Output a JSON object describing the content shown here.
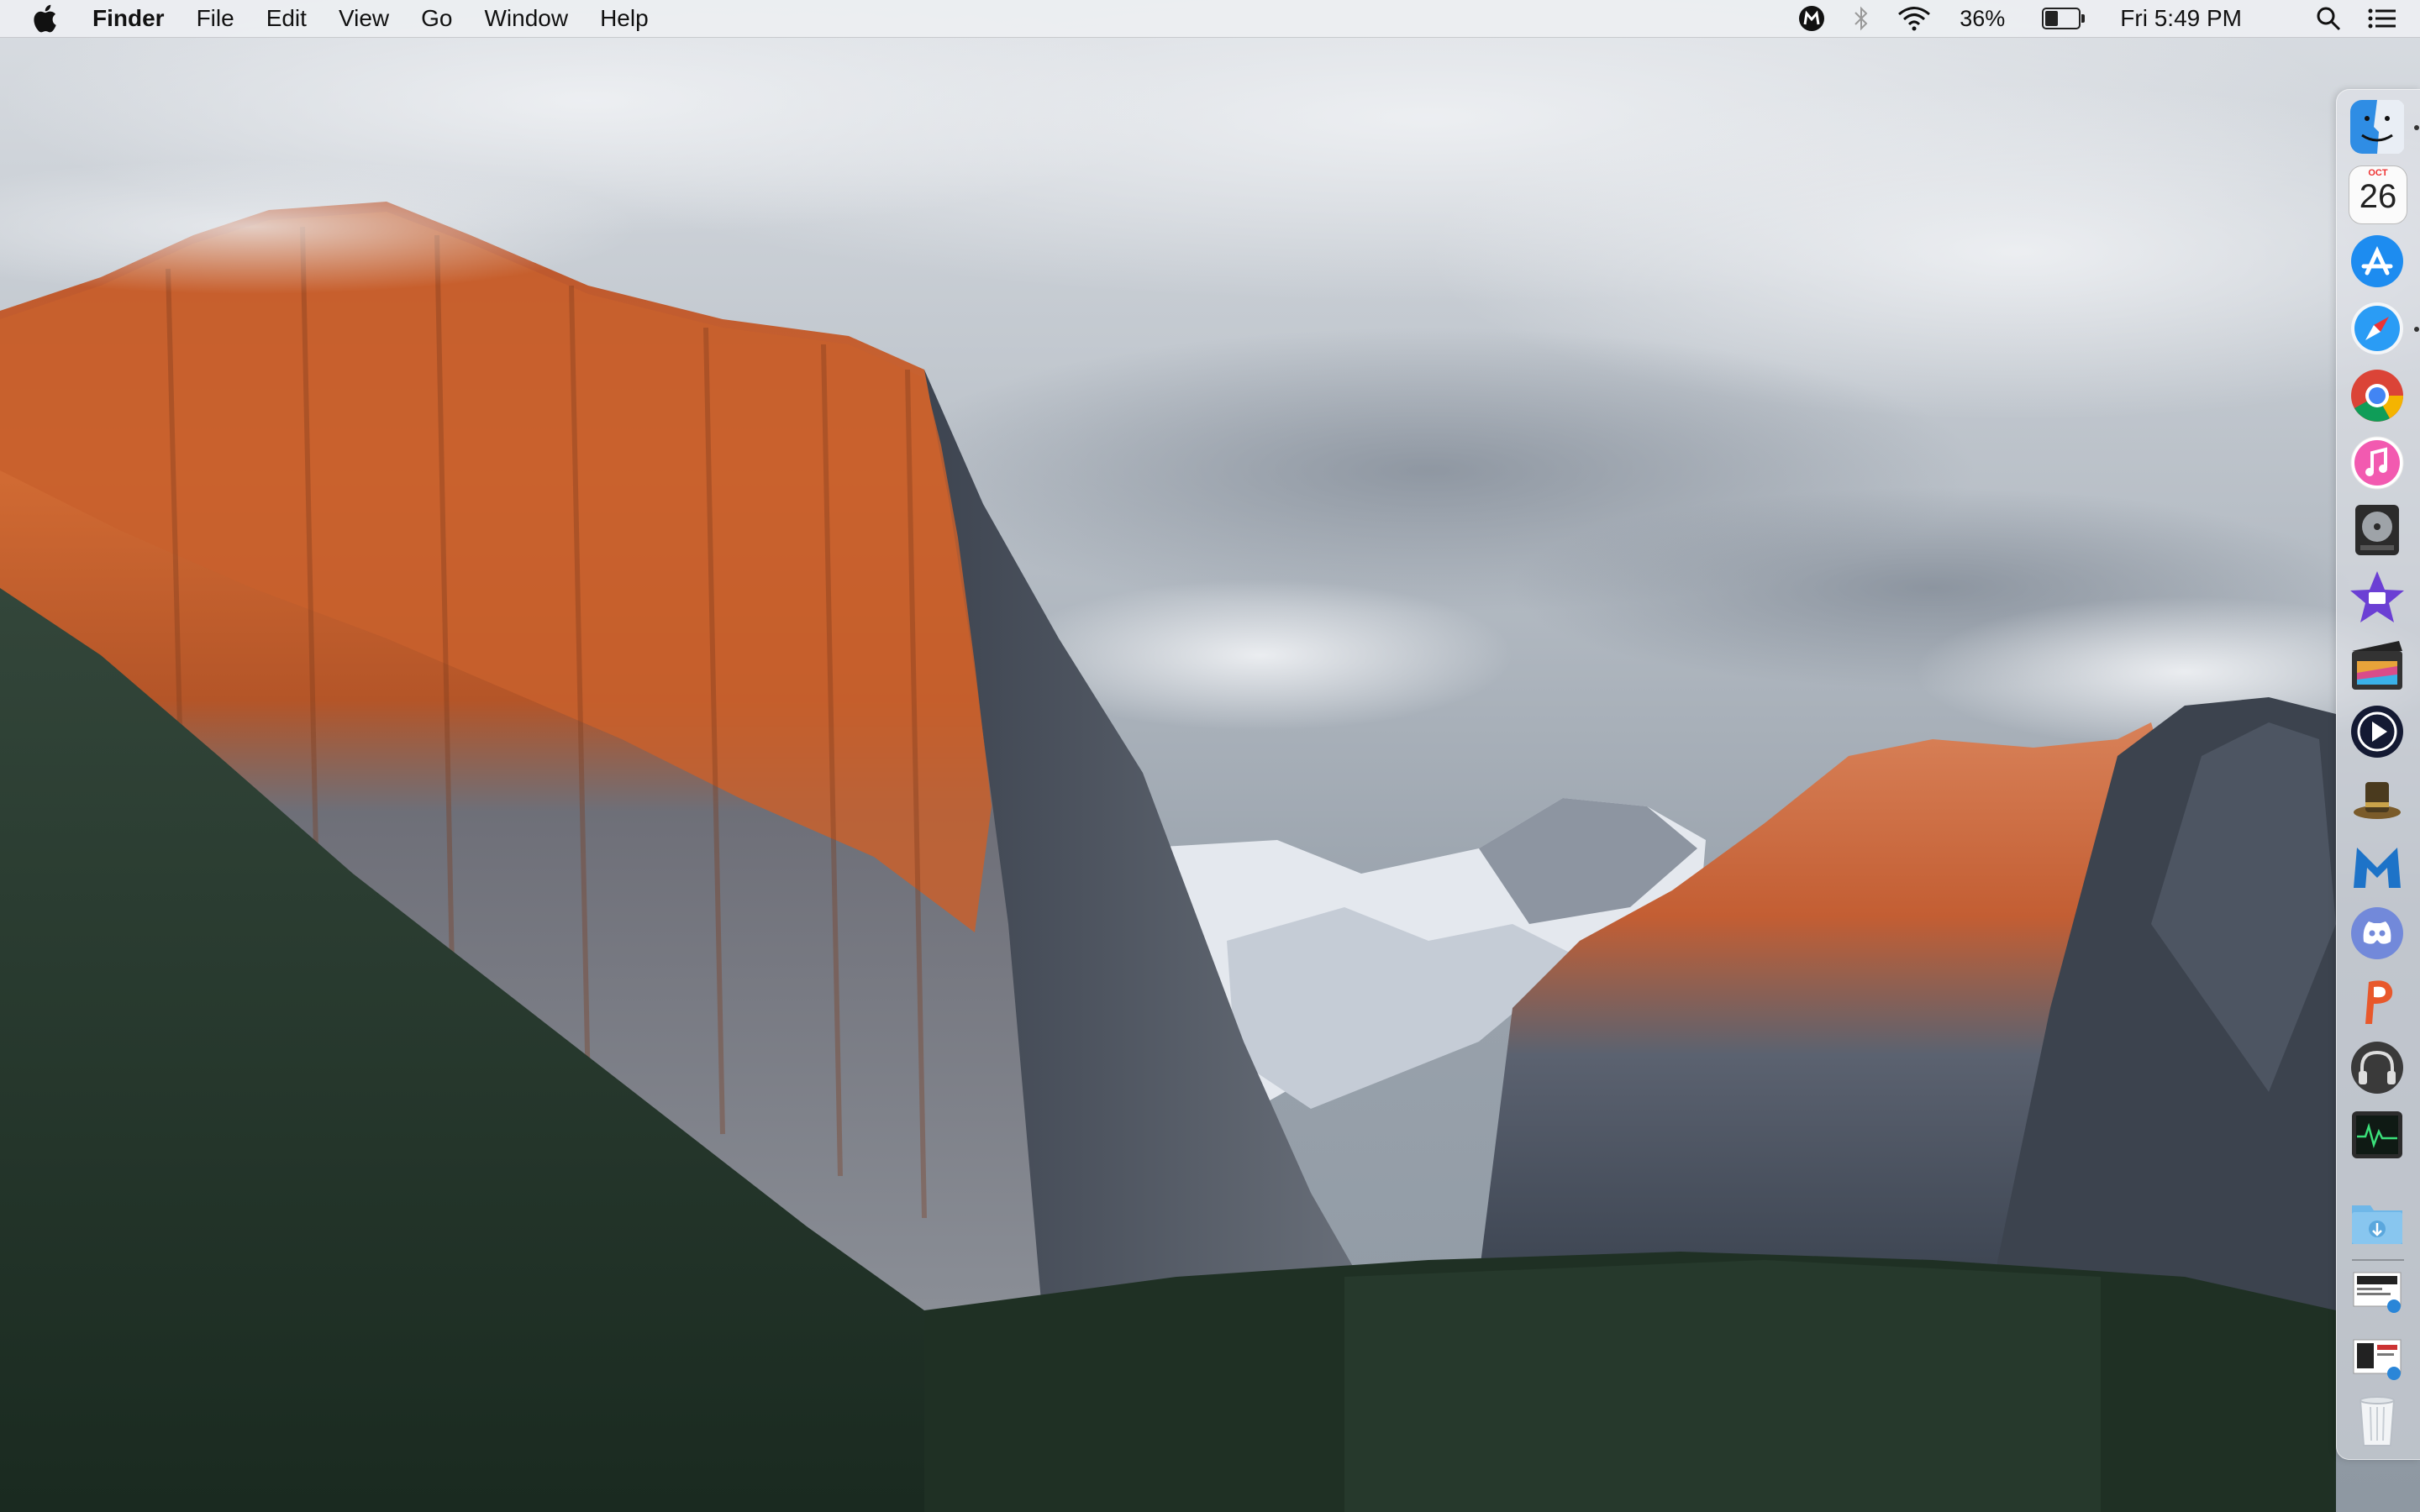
{
  "menubar": {
    "app_name": "Finder",
    "menus": [
      "File",
      "Edit",
      "View",
      "Go",
      "Window",
      "Help"
    ],
    "battery_percent": "36%",
    "battery_level": 0.36,
    "clock": "Fri 5:49 PM"
  },
  "dock": {
    "items": [
      {
        "name": "Finder",
        "icon": "finder-icon",
        "running": true
      },
      {
        "name": "Calendar",
        "icon": "calendar-icon",
        "month": "OCT",
        "day": "26"
      },
      {
        "name": "App Store",
        "icon": "app-store-icon"
      },
      {
        "name": "Safari",
        "icon": "safari-icon",
        "running": true
      },
      {
        "name": "Google Chrome",
        "icon": "chrome-icon"
      },
      {
        "name": "iTunes",
        "icon": "itunes-icon"
      },
      {
        "name": "Logic / Disk Utility",
        "icon": "disk-icon"
      },
      {
        "name": "iMovie",
        "icon": "imovie-icon"
      },
      {
        "name": "Final Cut Pro",
        "icon": "final-cut-icon"
      },
      {
        "name": "Infuse",
        "icon": "play-icon"
      },
      {
        "name": "Alfred",
        "icon": "hat-icon"
      },
      {
        "name": "Malwarebytes",
        "icon": "malwarebytes-icon"
      },
      {
        "name": "Discord",
        "icon": "discord-icon"
      },
      {
        "name": "Pages",
        "icon": "p-app-icon"
      },
      {
        "name": "Headphones",
        "icon": "headphones-icon"
      },
      {
        "name": "Activity Monitor",
        "icon": "activity-monitor-icon"
      },
      {
        "name": "Downloads",
        "icon": "downloads-folder-icon"
      },
      {
        "name": "Document 1",
        "icon": "document-stack-icon"
      },
      {
        "name": "Document 2",
        "icon": "document-stack-icon"
      },
      {
        "name": "Trash",
        "icon": "trash-icon"
      }
    ]
  },
  "colors": {
    "menubar_bg": "#eceef1",
    "rock_orange": "#c85a2a",
    "forest": "#243a2a"
  }
}
